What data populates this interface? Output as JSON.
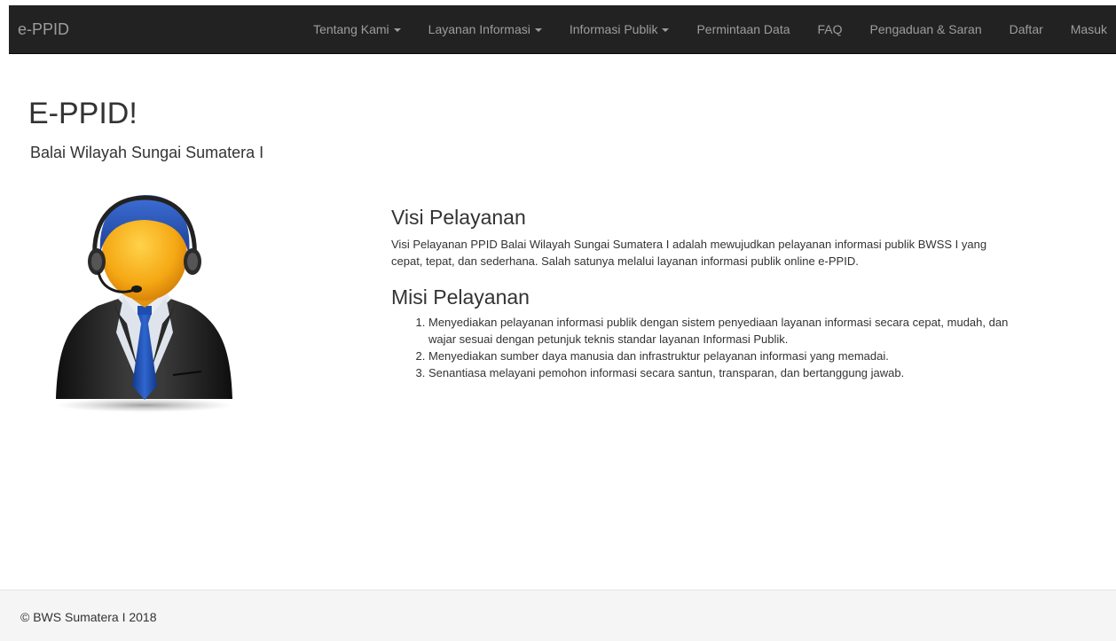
{
  "navbar": {
    "brand": "e-PPID",
    "items": [
      {
        "label": "Tentang Kami",
        "dropdown": true
      },
      {
        "label": "Layanan Informasi",
        "dropdown": true
      },
      {
        "label": "Informasi Publik",
        "dropdown": true
      },
      {
        "label": "Permintaan Data",
        "dropdown": false
      },
      {
        "label": "FAQ",
        "dropdown": false
      },
      {
        "label": "Pengaduan & Saran",
        "dropdown": false
      },
      {
        "label": "Daftar",
        "dropdown": false
      },
      {
        "label": "Masuk",
        "dropdown": false
      }
    ]
  },
  "header": {
    "title": "E-PPID!",
    "subtitle": "Balai Wilayah Sungai Sumatera I"
  },
  "avatar": {
    "icon": "customer-service-agent-icon"
  },
  "visi": {
    "heading": "Visi Pelayanan",
    "text": "Visi Pelayanan PPID Balai Wilayah Sungai Sumatera I adalah mewujudkan pelayanan informasi publik BWSS I yang cepat, tepat, dan sederhana. Salah satunya melalui layanan informasi publik online e-PPID."
  },
  "misi": {
    "heading": "Misi Pelayanan",
    "items": [
      "Menyediakan pelayanan informasi publik dengan sistem penyediaan layanan informasi secara cepat, mudah, dan wajar sesuai dengan petunjuk teknis standar layanan Informasi Publik.",
      "Menyediakan sumber daya manusia dan infrastruktur pelayanan informasi yang memadai.",
      "Senantiasa melayani pemohon informasi secara santun, transparan, dan bertanggung jawab."
    ]
  },
  "footer": {
    "text": "© BWS Sumatera I 2018"
  },
  "colors": {
    "navbar_bg": "#222222",
    "nav_text": "#9d9d9d",
    "footer_bg": "#f5f5f5",
    "suit": "#1f1f1f",
    "tie": "#1f4fa8",
    "face": "#f5a814"
  }
}
